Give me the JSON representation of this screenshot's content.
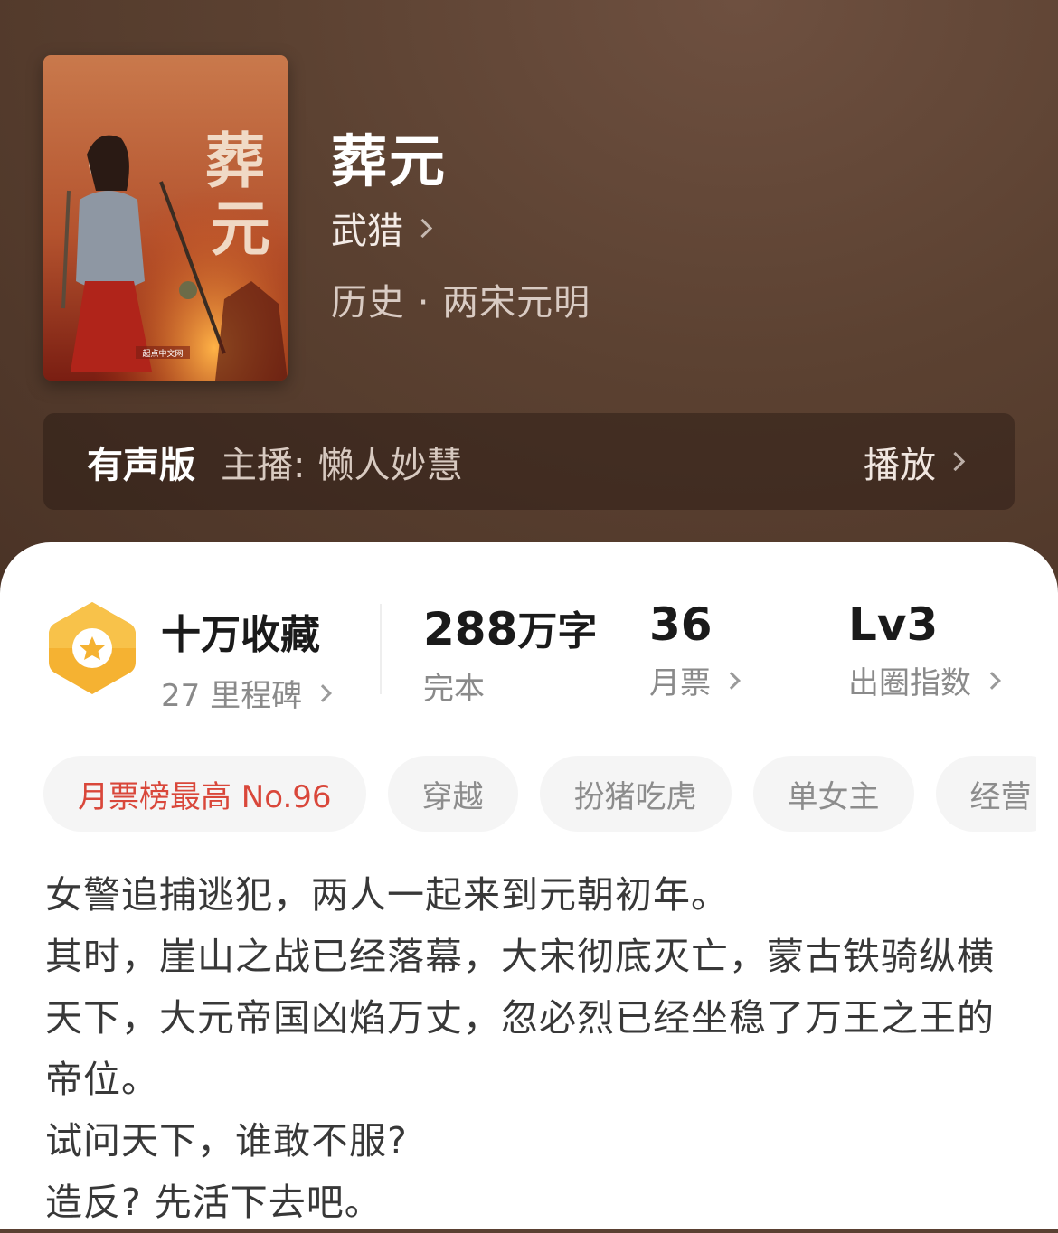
{
  "book": {
    "title": "葬元",
    "author": "武猎",
    "genre": "历史 · 两宋元明",
    "cover": {
      "title_chars": [
        "葬",
        "元"
      ],
      "publisher_mark": "起点中文网"
    }
  },
  "audio": {
    "label": "有声版",
    "host_label": "主播:",
    "host_name": "懒人妙慧",
    "play_label": "播放"
  },
  "stats": {
    "favorites": {
      "title": "十万收藏",
      "subtitle": "27 里程碑"
    },
    "words": {
      "number": "288",
      "unit": "万字",
      "subtitle": "完本"
    },
    "monthly": {
      "value": "36",
      "subtitle": "月票"
    },
    "influence": {
      "value": "Lv3",
      "subtitle": "出圈指数"
    }
  },
  "tags": [
    "月票榜最高 No.96",
    "穿越",
    "扮猪吃虎",
    "单女主",
    "经营"
  ],
  "description": [
    "女警追捕逃犯，两人一起来到元朝初年。",
    "其时，崖山之战已经落幕，大宋彻底灭亡，蒙古铁骑纵横天下，大元帝国凶焰万丈，忽必烈已经坐稳了万王之王的帝位。",
    "试问天下，谁敢不服?",
    "造反? 先活下去吧。"
  ],
  "colors": {
    "header_bg": "#5b4131",
    "tag_highlight": "#d9473a",
    "badge": "#f5b232"
  }
}
